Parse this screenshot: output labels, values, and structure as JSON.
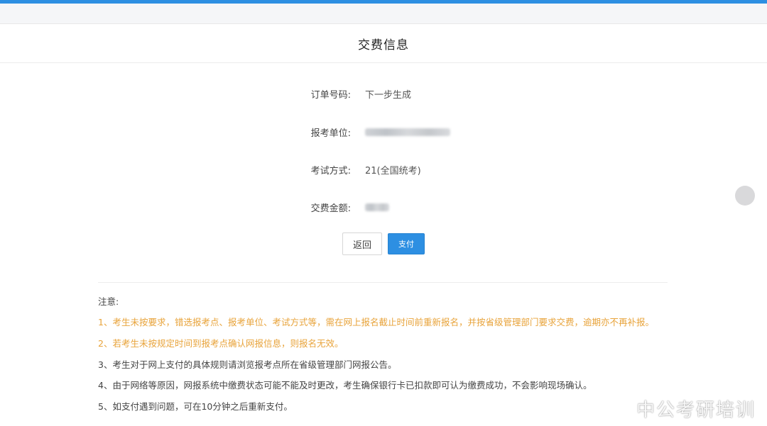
{
  "header": {
    "title": "交费信息"
  },
  "order_info": {
    "order_no_label": "订单号码:",
    "order_no_value": "下一步生成",
    "unit_label": "报考单位:",
    "exam_mode_label": "考试方式:",
    "exam_mode_value": "21(全国统考)",
    "fee_label": "交费金额:"
  },
  "actions": {
    "back_label": "返回",
    "pay_label": "支付"
  },
  "notes": {
    "title": "注意:",
    "items": [
      "1、考生未按要求，错选报考点、报考单位、考试方式等，需在网上报名截止时间前重新报名，并按省级管理部门要求交费，逾期亦不再补报。",
      "2、若考生未按规定时间到报考点确认网报信息，则报名无效。",
      "3、考生对于网上支付的具体规则请浏览报考点所在省级管理部门网报公告。",
      "4、由于网络等原因，网报系统中缴费状态可能不能及时更改，考生确保银行卡已扣款即可认为缴费成功，不会影响现场确认。",
      "5、如支付遇到问题，可在10分钟之后重新支付。"
    ]
  },
  "watermark": {
    "text": "中公考研培训",
    "icon": "weibo-icon"
  },
  "colors": {
    "accent": "#2d8fe2",
    "warning_text": "#e8a33a"
  }
}
